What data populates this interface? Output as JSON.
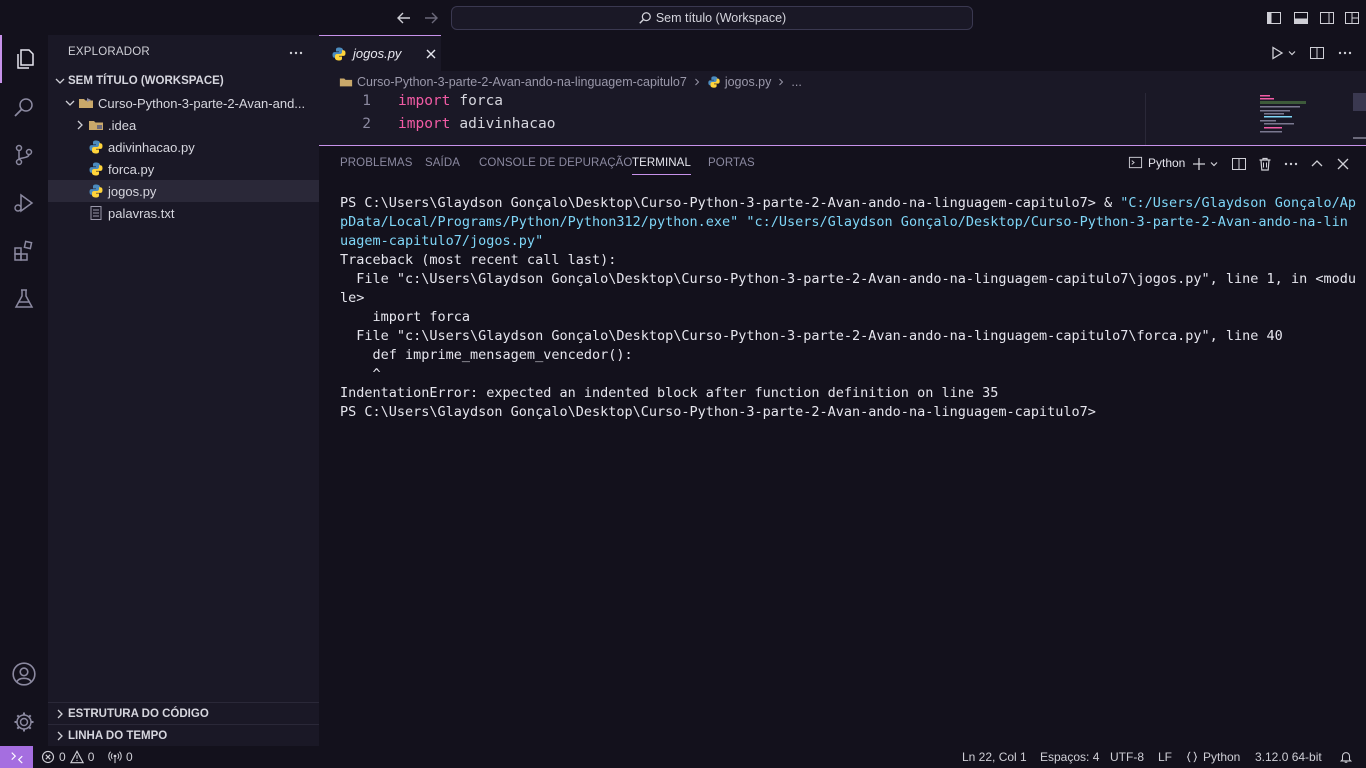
{
  "window": {
    "title": "Sem título (Workspace)"
  },
  "explorer": {
    "title": "EXPLORADOR",
    "workspace": "SEM TÍTULO (WORKSPACE)",
    "folder": "Curso-Python-3-parte-2-Avan-and...",
    "items": [
      {
        "label": ".idea",
        "type": "folder"
      },
      {
        "label": "adivinhacao.py",
        "type": "python"
      },
      {
        "label": "forca.py",
        "type": "python"
      },
      {
        "label": "jogos.py",
        "type": "python"
      },
      {
        "label": "palavras.txt",
        "type": "text"
      }
    ],
    "outline": "ESTRUTURA DO CÓDIGO",
    "timeline": "LINHA DO TEMPO"
  },
  "editor": {
    "tab": "jogos.py",
    "breadcrumb": {
      "folder": "Curso-Python-3-parte-2-Avan-ando-na-linguagem-capitulo7",
      "file": "jogos.py",
      "more": "..."
    },
    "lines": [
      {
        "num": "1",
        "kw": "import",
        "name": "forca"
      },
      {
        "num": "2",
        "kw": "import",
        "name": "adivinhacao"
      }
    ]
  },
  "panel": {
    "tabs": [
      "PROBLEMAS",
      "SAÍDA",
      "CONSOLE DE DEPURAÇÃO",
      "TERMINAL",
      "PORTAS"
    ],
    "active_tab": "TERMINAL",
    "shell": "Python",
    "terminal": {
      "l1_prompt": "PS C:\\Users\\Glaydson Gonçalo\\Desktop\\Curso-Python-3-parte-2-Avan-ando-na-linguagem-capitulo7> & ",
      "l1_str": "\"C:/Users/Glaydson Gonçalo/Ap",
      "l2": "pData/Local/Programs/Python/Python312/python.exe\" \"c:/Users/Glaydson Gonçalo/Desktop/Curso-Python-3-parte-2-Avan-ando-na-lin",
      "l3": "uagem-capitulo7/jogos.py\"",
      "l4": "Traceback (most recent call last):",
      "l5": "  File \"c:\\Users\\Glaydson Gonçalo\\Desktop\\Curso-Python-3-parte-2-Avan-ando-na-linguagem-capitulo7\\jogos.py\", line 1, in <modu",
      "l6": "le>",
      "l7": "    import forca",
      "l8": "  File \"c:\\Users\\Glaydson Gonçalo\\Desktop\\Curso-Python-3-parte-2-Avan-ando-na-linguagem-capitulo7\\forca.py\", line 40",
      "l9": "    def imprime_mensagem_vencedor():",
      "l10": "    ^",
      "l11": "IndentationError: expected an indented block after function definition on line 35",
      "l12": "PS C:\\Users\\Glaydson Gonçalo\\Desktop\\Curso-Python-3-parte-2-Avan-ando-na-linguagem-capitulo7>"
    }
  },
  "status": {
    "errors": "0",
    "warnings": "0",
    "ports": "0",
    "position": "Ln 22, Col 1",
    "spaces": "Espaços: 4",
    "encoding": "UTF-8",
    "eol": "LF",
    "language": "Python",
    "interpreter": "3.12.0 64-bit"
  },
  "colors": {
    "accent": "#c792ea",
    "keyword": "#f25ba5",
    "string": "#7fd6f7",
    "remote": "#a56ee0"
  }
}
